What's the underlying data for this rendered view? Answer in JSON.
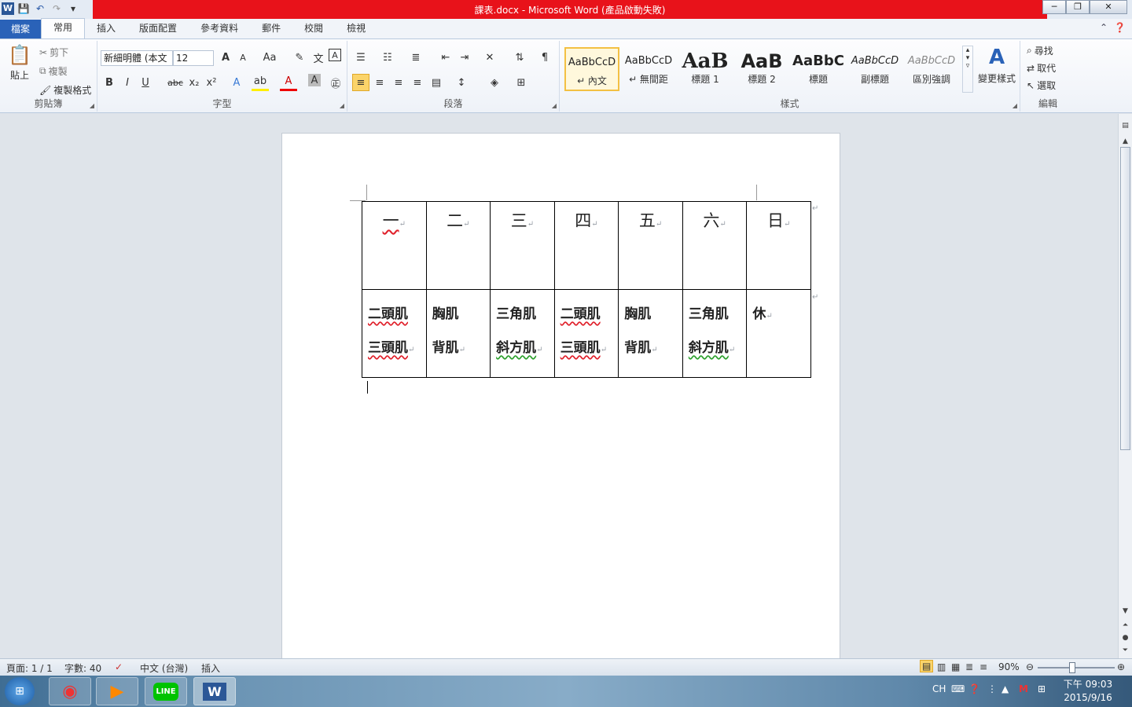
{
  "window": {
    "title": "課表.docx - Microsoft Word (產品啟動失敗)",
    "controls": {
      "minimize": "─",
      "restore": "❐",
      "close": "✕"
    }
  },
  "qat": {
    "app_icon": "W",
    "save": "💾",
    "undo": "↶",
    "redo": "↷",
    "customize": "▾"
  },
  "tabs": [
    "檔案",
    "常用",
    "插入",
    "版面配置",
    "參考資料",
    "郵件",
    "校閱",
    "檢視"
  ],
  "ribbon": {
    "clipboard": {
      "label": "剪貼簿",
      "paste": "貼上",
      "cut": "剪下",
      "copy": "複製",
      "format_painter": "複製格式"
    },
    "font": {
      "label": "字型",
      "font_name": "新細明體 (本文",
      "font_size": "12",
      "grow": "A",
      "shrink": "A",
      "case": "Aa",
      "bold": "B",
      "italic": "I",
      "underline": "U",
      "strike": "abc",
      "sub": "x₂",
      "sup": "x²",
      "font_color": "A"
    },
    "paragraph": {
      "label": "段落"
    },
    "styles": {
      "label": "樣式",
      "items": [
        {
          "preview": "AaBbCcD",
          "name": "↵ 內文"
        },
        {
          "preview": "AaBbCcD",
          "name": "↵ 無間距"
        },
        {
          "preview": "AaB",
          "name": "標題 1"
        },
        {
          "preview": "AaB",
          "name": "標題 2"
        },
        {
          "preview": "AaBbC",
          "name": "標題"
        },
        {
          "preview": "AaBbCcD",
          "name": "副標題"
        },
        {
          "preview": "AaBbCcD",
          "name": "區別強調"
        }
      ],
      "change_styles": "變更樣式"
    },
    "editing": {
      "label": "編輯",
      "find": "尋找",
      "replace": "取代",
      "select": "選取"
    }
  },
  "document": {
    "table": {
      "days": [
        "一",
        "二",
        "三",
        "四",
        "五",
        "六",
        "日"
      ],
      "workouts": [
        [
          "二頭肌",
          "三頭肌"
        ],
        [
          "胸肌",
          "背肌"
        ],
        [
          "三角肌",
          "斜方肌"
        ],
        [
          "二頭肌",
          "三頭肌"
        ],
        [
          "胸肌",
          "背肌"
        ],
        [
          "三角肌",
          "斜方肌"
        ],
        [
          "休",
          ""
        ]
      ]
    },
    "para_mark": "↵"
  },
  "statusbar": {
    "page": "頁面: 1 / 1",
    "words": "字數: 40",
    "language": "中文 (台灣)",
    "mode": "插入",
    "zoom": "90%"
  },
  "taskbar": {
    "tray_lang": "CH",
    "time": "下午 09:03",
    "date": "2015/9/16"
  }
}
